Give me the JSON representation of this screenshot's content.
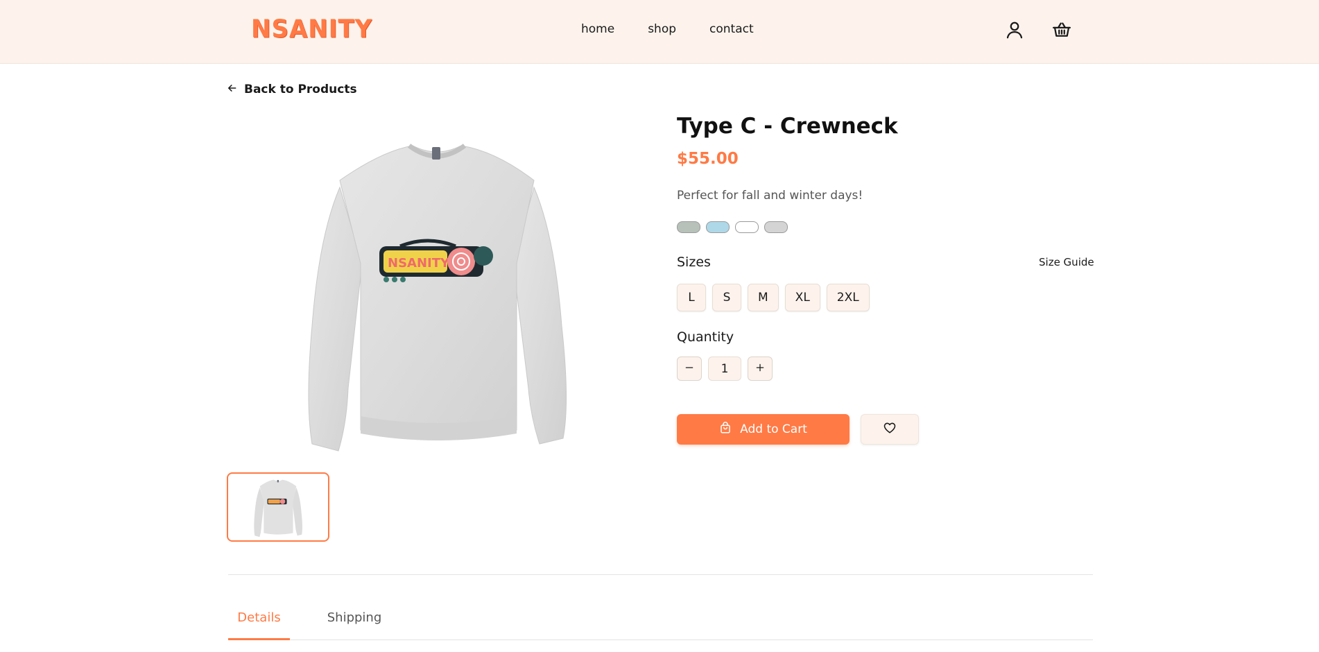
{
  "brand": {
    "logo_text": "NSANITY",
    "accent_color": "#ff7a45",
    "header_bg": "#fdf3ec"
  },
  "nav": {
    "items": [
      "home",
      "shop",
      "contact"
    ]
  },
  "header_icons": [
    "user-icon",
    "basket-icon"
  ],
  "back_link": {
    "label": "Back to Products",
    "icon": "arrow-left-icon"
  },
  "product": {
    "title": "Type C - Crewneck",
    "price": "$55.00",
    "description": "Perfect for fall and winter days!",
    "colors": [
      "#b7c1b9",
      "#aed8e8",
      "#ffffff",
      "#d4d4d4"
    ],
    "sizes_label": "Sizes",
    "size_guide_label": "Size Guide",
    "sizes": [
      "L",
      "S",
      "M",
      "XL",
      "2XL"
    ],
    "quantity_label": "Quantity",
    "quantity": "1",
    "add_to_cart_label": "Add to Cart"
  },
  "tabs": [
    {
      "label": "Details",
      "active": true
    },
    {
      "label": "Shipping",
      "active": false
    }
  ]
}
